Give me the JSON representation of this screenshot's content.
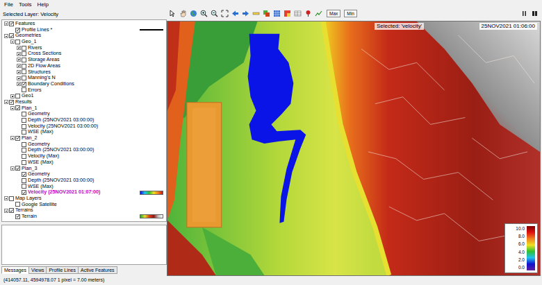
{
  "window": {
    "menu": [
      "File",
      "Tools",
      "Help"
    ],
    "selected_layer": "Selected Layer: Velocity"
  },
  "tree": [
    {
      "label": "Features",
      "depth": 0,
      "expandable": true,
      "expanded": true,
      "checked": true,
      "selected": false,
      "legend": "none"
    },
    {
      "label": "Profile Lines *",
      "depth": 1,
      "expandable": false,
      "expanded": false,
      "checked": true,
      "selected": false,
      "legend": "line"
    },
    {
      "label": "Geometries",
      "depth": 0,
      "expandable": true,
      "expanded": true,
      "checked": true,
      "selected": false,
      "legend": "none"
    },
    {
      "label": "Geo_1",
      "depth": 1,
      "expandable": true,
      "expanded": true,
      "checked": false,
      "selected": false,
      "legend": "none"
    },
    {
      "label": "Rivers",
      "depth": 2,
      "expandable": true,
      "expanded": false,
      "checked": false,
      "selected": false,
      "legend": "none"
    },
    {
      "label": "Cross Sections",
      "depth": 2,
      "expandable": true,
      "expanded": false,
      "checked": false,
      "selected": false,
      "legend": "none"
    },
    {
      "label": "Storage Areas",
      "depth": 2,
      "expandable": true,
      "expanded": false,
      "checked": false,
      "selected": false,
      "legend": "none"
    },
    {
      "label": "2D Flow Areas",
      "depth": 2,
      "expandable": true,
      "expanded": false,
      "checked": false,
      "selected": false,
      "legend": "none"
    },
    {
      "label": "Structures",
      "depth": 2,
      "expandable": true,
      "expanded": false,
      "checked": false,
      "selected": false,
      "legend": "none"
    },
    {
      "label": "Manning's N",
      "depth": 2,
      "expandable": true,
      "expanded": false,
      "checked": false,
      "selected": false,
      "legend": "none"
    },
    {
      "label": "Boundary Conditions",
      "depth": 2,
      "expandable": true,
      "expanded": false,
      "checked": true,
      "selected": false,
      "legend": "none"
    },
    {
      "label": "Errors",
      "depth": 2,
      "expandable": false,
      "expanded": false,
      "checked": false,
      "selected": false,
      "legend": "none"
    },
    {
      "label": "Geo1",
      "depth": 1,
      "expandable": true,
      "expanded": false,
      "checked": false,
      "selected": false,
      "legend": "none"
    },
    {
      "label": "Results",
      "depth": 0,
      "expandable": true,
      "expanded": true,
      "checked": true,
      "selected": false,
      "legend": "none"
    },
    {
      "label": "Plan_1",
      "depth": 1,
      "expandable": true,
      "expanded": true,
      "checked": true,
      "selected": false,
      "legend": "none"
    },
    {
      "label": "Geometry",
      "depth": 2,
      "expandable": false,
      "expanded": false,
      "checked": false,
      "selected": false,
      "legend": "none"
    },
    {
      "label": "Depth (25NOV2021 03:00:00)",
      "depth": 2,
      "expandable": false,
      "expanded": false,
      "checked": false,
      "selected": false,
      "legend": "none"
    },
    {
      "label": "Velocity (25NOV2021 03:00:00)",
      "depth": 2,
      "expandable": false,
      "expanded": false,
      "checked": false,
      "selected": false,
      "legend": "none"
    },
    {
      "label": "WSE (Max)",
      "depth": 2,
      "expandable": false,
      "expanded": false,
      "checked": false,
      "selected": false,
      "legend": "none"
    },
    {
      "label": "Plan_2",
      "depth": 1,
      "expandable": true,
      "expanded": true,
      "checked": true,
      "selected": false,
      "legend": "none"
    },
    {
      "label": "Geometry",
      "depth": 2,
      "expandable": false,
      "expanded": false,
      "checked": false,
      "selected": false,
      "legend": "none"
    },
    {
      "label": "Depth (25NOV2021 03:00:00)",
      "depth": 2,
      "expandable": false,
      "expanded": false,
      "checked": false,
      "selected": false,
      "legend": "none"
    },
    {
      "label": "Velocity (Max)",
      "depth": 2,
      "expandable": false,
      "expanded": false,
      "checked": false,
      "selected": false,
      "legend": "none"
    },
    {
      "label": "WSE (Max)",
      "depth": 2,
      "expandable": false,
      "expanded": false,
      "checked": false,
      "selected": false,
      "legend": "none"
    },
    {
      "label": "Plan_3",
      "depth": 1,
      "expandable": true,
      "expanded": true,
      "checked": true,
      "selected": false,
      "legend": "none"
    },
    {
      "label": "Geometry",
      "depth": 2,
      "expandable": false,
      "expanded": false,
      "checked": true,
      "selected": false,
      "legend": "none"
    },
    {
      "label": "Depth (25NOV2021 03:00:00)",
      "depth": 2,
      "expandable": false,
      "expanded": false,
      "checked": false,
      "selected": false,
      "legend": "none"
    },
    {
      "label": "WSE (Max)",
      "depth": 2,
      "expandable": false,
      "expanded": false,
      "checked": false,
      "selected": false,
      "legend": "none"
    },
    {
      "label": "Velocity (25NOV2021 01:07:00)",
      "depth": 2,
      "expandable": false,
      "expanded": false,
      "checked": true,
      "selected": true,
      "legend": "velocity"
    },
    {
      "label": "Map Layers",
      "depth": 0,
      "expandable": true,
      "expanded": true,
      "checked": false,
      "selected": false,
      "legend": "none"
    },
    {
      "label": "Google Satellite",
      "depth": 1,
      "expandable": false,
      "expanded": false,
      "checked": false,
      "selected": false,
      "legend": "none"
    },
    {
      "label": "Terrains",
      "depth": 0,
      "expandable": true,
      "expanded": true,
      "checked": true,
      "selected": false,
      "legend": "none"
    },
    {
      "label": "Terrain",
      "depth": 1,
      "expandable": false,
      "expanded": false,
      "checked": true,
      "selected": false,
      "legend": "terrain"
    }
  ],
  "toolbar": {
    "buttons": [
      "Max",
      "Min"
    ]
  },
  "map": {
    "selected_label": "Selected: 'velocity'",
    "timestamp": "25NOV2021 01:06:00",
    "legend": [
      "10.0",
      "8.0",
      "6.0",
      "4.0",
      "2.0",
      "0.0"
    ]
  },
  "bottom_tabs": [
    {
      "label": "Messages",
      "selected": true
    },
    {
      "label": "Views",
      "selected": false
    },
    {
      "label": "Profile Lines",
      "selected": false
    },
    {
      "label": "Active Features",
      "selected": false
    }
  ],
  "status_bar": "(414057.11, 4594978.07  1 pixel = 7.00 meters)"
}
